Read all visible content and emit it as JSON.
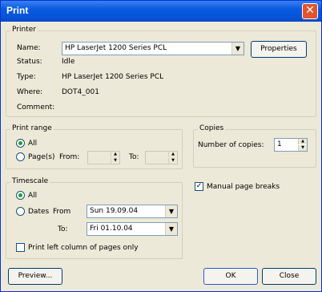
{
  "window": {
    "title": "Print",
    "close_label": "✕"
  },
  "printer": {
    "group_label": "Printer",
    "name_label": "Name:",
    "name_value": "HP LaserJet 1200 Series PCL",
    "properties_label": "Properties",
    "status_label": "Status:",
    "status_value": "Idle",
    "type_label": "Type:",
    "type_value": "HP LaserJet 1200 Series PCL",
    "where_label": "Where:",
    "where_value": "DOT4_001",
    "comment_label": "Comment:",
    "comment_value": ""
  },
  "print_range": {
    "group_label": "Print range",
    "all_label": "All",
    "pages_label": "Page(s)",
    "from_label": "From:",
    "from_value": "",
    "to_label": "To:",
    "to_value": ""
  },
  "copies": {
    "group_label": "Copies",
    "number_label": "Number of copies:",
    "number_value": "1"
  },
  "timescale": {
    "group_label": "Timescale",
    "all_label": "All",
    "dates_label": "Dates",
    "from_label": "From",
    "from_value": "Sun 19.09.04",
    "to_label": "To:",
    "to_value": "Fri 01.10.04",
    "print_left_label": "Print left column of pages only"
  },
  "manual_breaks_label": "Manual page breaks",
  "buttons": {
    "preview": "Preview...",
    "ok": "OK",
    "close": "Close"
  },
  "colors": {
    "title_bar": "#0a5ae0",
    "dialog_bg": "#ece9d8",
    "selected_radio": "#21a121"
  }
}
